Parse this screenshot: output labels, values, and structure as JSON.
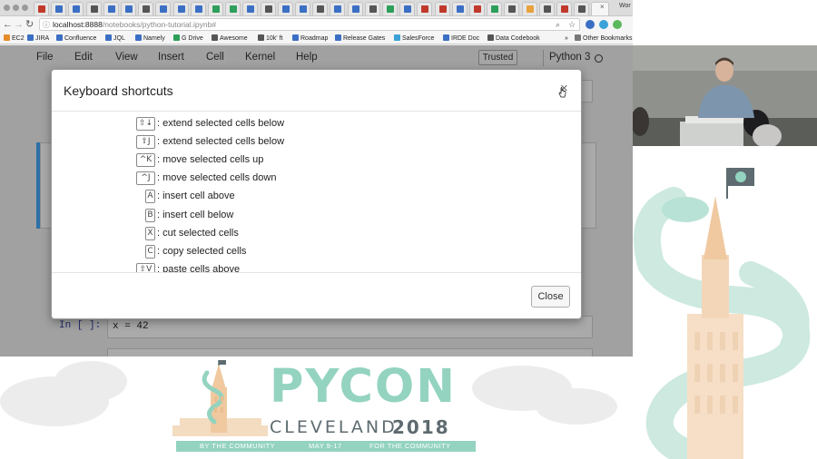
{
  "browser": {
    "window_title": "Wor",
    "url_host": "localhost:8888",
    "url_path": "/notebooks/python-tutorial.ipynb#",
    "tab_close_glyph": "×",
    "tab_colors": [
      "#c0392b",
      "#3b6fc4",
      "#3b6fc4",
      "#555555",
      "#3b6fc4",
      "#3b6fc4",
      "#555555",
      "#3b6fc4",
      "#3b6fc4",
      "#3b6fc4",
      "#2e9e5b",
      "#2e9e5b",
      "#3b6fc4",
      "#555555",
      "#3b6fc4",
      "#3b6fc4",
      "#555555",
      "#3b6fc4",
      "#3b6fc4",
      "#555555",
      "#2e9e5b",
      "#3b6fc4",
      "#c0392b",
      "#c0392b",
      "#3b6fc4",
      "#c0392b",
      "#2e9e5b",
      "#555555",
      "#e8a33d",
      "#555555",
      "#c0392b",
      "#555555"
    ],
    "bookmarks": [
      {
        "label": "EC2",
        "color": "#e58d2a"
      },
      {
        "label": "JIRA",
        "color": "#3b6fc4"
      },
      {
        "label": "Confluence",
        "color": "#3b6fc4"
      },
      {
        "label": "JQL",
        "color": "#3b6fc4"
      },
      {
        "label": "Namely",
        "color": "#3b6fc4"
      },
      {
        "label": "G Drive",
        "color": "#2e9e5b"
      },
      {
        "label": "Awesome",
        "color": "#555555"
      },
      {
        "label": "10k' ft",
        "color": "#555555"
      },
      {
        "label": "Roadmap",
        "color": "#3b6fc4"
      },
      {
        "label": "Release Gates",
        "color": "#3b6fc4"
      },
      {
        "label": "SalesForce",
        "color": "#3ba1d8"
      },
      {
        "label": "IRDE Doc",
        "color": "#3b6fc4"
      },
      {
        "label": "Data Codebook",
        "color": "#555555"
      }
    ],
    "bookmarks_overflow": "»",
    "other_bookmarks": "Other Bookmarks"
  },
  "jupyter": {
    "menu": [
      "File",
      "Edit",
      "View",
      "Insert",
      "Cell",
      "Kernel",
      "Help"
    ],
    "trusted_label": "Trusted",
    "kernel_name": "Python 3",
    "cell_prompt": "In [ ]:",
    "cell_code": "x = 42"
  },
  "modal": {
    "title": "Keyboard shortcuts",
    "close_x": "×",
    "close_button": "Close",
    "shortcuts": [
      {
        "key": "⇧↓",
        "desc": ": extend selected cells below"
      },
      {
        "key": "⇧J",
        "desc": ": extend selected cells below"
      },
      {
        "key": "^K",
        "desc": ": move selected cells up"
      },
      {
        "key": "^J",
        "desc": ": move selected cells down"
      },
      {
        "key": "A",
        "desc": ": insert cell above"
      },
      {
        "key": "B",
        "desc": ": insert cell below"
      },
      {
        "key": "X",
        "desc": ": cut selected cells"
      },
      {
        "key": "C",
        "desc": ": copy selected cells"
      },
      {
        "key": "⇧V",
        "desc": ": paste cells above"
      }
    ]
  },
  "branding": {
    "pycon": "PYCON",
    "city": "CLEVELAND",
    "year": "2018",
    "ribbon": [
      "BY THE COMMUNITY",
      "MAY 9-17",
      "FOR THE COMMUNITY"
    ],
    "mint_color": "#93d3c0",
    "slate_color": "#5e6b70",
    "tower_color": "#f0c9a0"
  }
}
